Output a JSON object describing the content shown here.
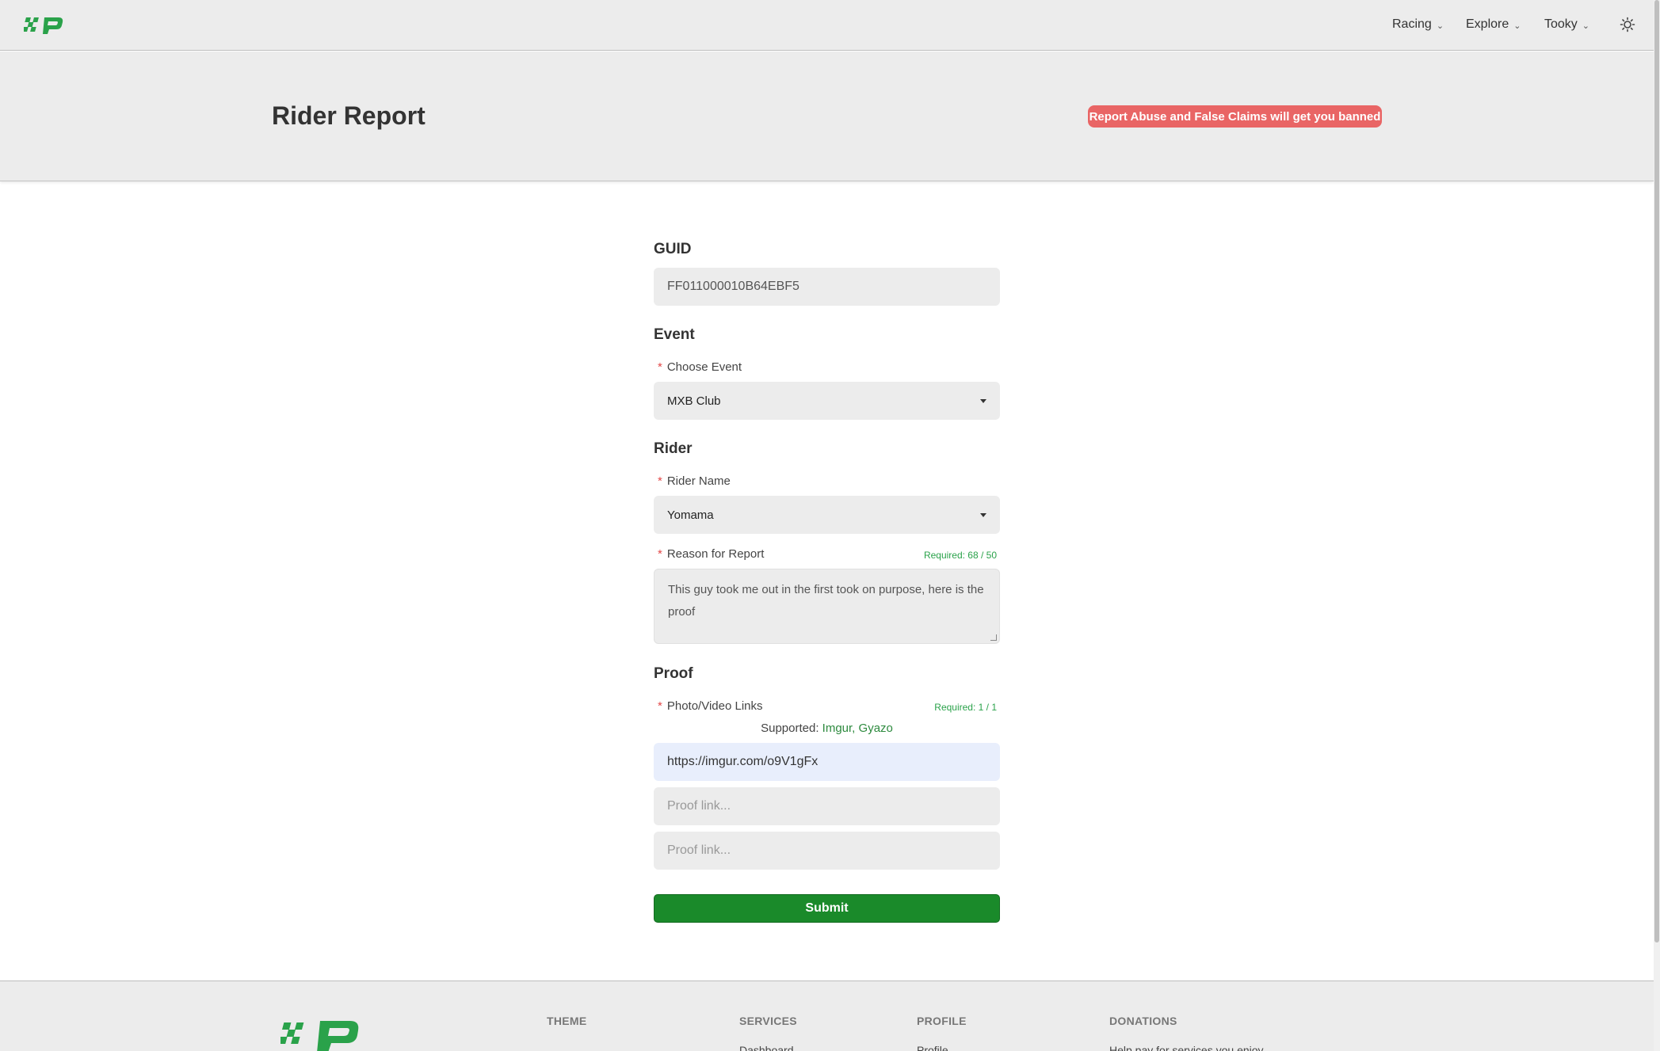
{
  "nav": {
    "items": [
      {
        "label": "Racing"
      },
      {
        "label": "Explore"
      },
      {
        "label": "Tooky"
      }
    ]
  },
  "header": {
    "title": "Rider Report",
    "warning": "Report Abuse and False Claims will get you banned"
  },
  "form": {
    "guid": {
      "section": "GUID",
      "value": "FF011000010B64EBF5"
    },
    "event": {
      "section": "Event",
      "label": "Choose Event",
      "required_mark": "*",
      "selected": "MXB Club"
    },
    "rider": {
      "section": "Rider",
      "label": "Rider Name",
      "required_mark": "*",
      "selected": "Yomama"
    },
    "reason": {
      "label": "Reason for Report",
      "required_mark": "*",
      "count": "Required: 68 / 50",
      "value": "This guy took me out in the first took on purpose, here is the proof"
    },
    "proof": {
      "section": "Proof",
      "label": "Photo/Video Links",
      "required_mark": "*",
      "count": "Required: 1 / 1",
      "supported_prefix": "Supported:",
      "supported_links": "Imgur, Gyazo",
      "links": [
        {
          "value": "https://imgur.com/o9V1gFx",
          "placeholder": "Proof link..."
        },
        {
          "value": "",
          "placeholder": "Proof link..."
        },
        {
          "value": "",
          "placeholder": "Proof link..."
        }
      ]
    },
    "submit_label": "Submit"
  },
  "footer": {
    "columns": [
      {
        "heading": "THEME",
        "link": ""
      },
      {
        "heading": "SERVICES",
        "link": "Dashboard"
      },
      {
        "heading": "PROFILE",
        "link": "Profile"
      },
      {
        "heading": "DONATIONS",
        "link": "Help pay for services you enjoy"
      }
    ]
  },
  "colors": {
    "brand_green": "#2aa24a",
    "submit_green": "#1a8a2a",
    "warning_red": "#e96565",
    "required_red": "#e34848"
  },
  "icons": {
    "logo": "checkered-p-logo",
    "theme_toggle": "sun-icon",
    "chevrons": "chevron-down-icon",
    "select_caret": "caret-down-icon"
  }
}
